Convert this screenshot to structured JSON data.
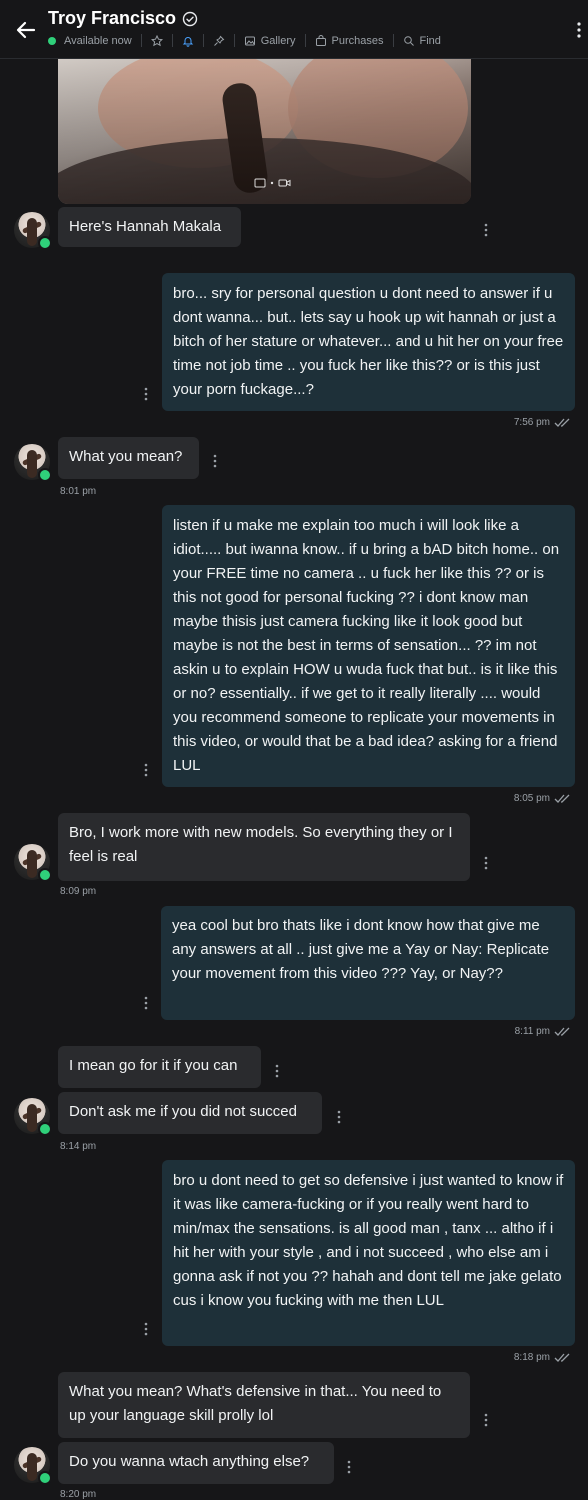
{
  "header": {
    "title": "Troy Francisco",
    "status": "Available now",
    "links": {
      "gallery": "Gallery",
      "purchases": "Purchases",
      "find": "Find"
    }
  },
  "messages": [
    {
      "side": "in",
      "text": "Here's Hannah Makala",
      "time": ""
    },
    {
      "side": "out",
      "text": "bro... sry for personal question u dont need to answer if u dont wanna... but.. lets say u hook up wit hannah or just a bitch of her stature or whatever... and u hit her on your free time not job time .. you fuck her like this?? or is this just your porn fuckage...?",
      "time": "7:56 pm"
    },
    {
      "side": "in",
      "text": "What you mean?",
      "time": "8:01 pm"
    },
    {
      "side": "out",
      "text": "listen if u make me explain too much i will look like a idiot..... but iwanna know.. if u bring a bAD bitch home.. on your FREE time no camera .. u fuck her like this ?? or is this not good for personal fucking ?? i dont know man maybe thisis just camera fucking like it look good but maybe is not the best in terms of sensation... ?? im not askin u to explain HOW u wuda fuck that but.. is it like this or no? essentially.. if we get to it really literally .... would you recommend someone to replicate your movements in this video, or would that be a bad idea? asking for a friend LUL",
      "time": "8:05 pm"
    },
    {
      "side": "in",
      "text": "Bro, I work more with new models. So everything they or I feel is real",
      "time": "8:09 pm"
    },
    {
      "side": "out",
      "text": "yea cool but bro thats like i dont know how that give me any answers at all .. just give me a Yay or Nay: Replicate your movement from this video ??? Yay, or Nay??",
      "time": "8:11 pm"
    },
    {
      "side": "in",
      "text": "I mean go for it if you can",
      "time": ""
    },
    {
      "side": "in",
      "text": "Don't ask me if you did not succed",
      "time": "8:14 pm"
    },
    {
      "side": "out",
      "text": "bro u dont need to get so defensive i just wanted to know if it was like camera-fucking or if you really went hard to min/max the sensations. is all good man , tanx ... altho if i hit her with your style , and i not succeed , who else am i gonna ask if not you ?? hahah and dont tell me jake gelato cus i know you fucking with me then LUL",
      "time": "8:18 pm"
    },
    {
      "side": "in",
      "text": "What you mean? What's defensive in that... You need to up your language skill prolly lol",
      "time": ""
    },
    {
      "side": "in",
      "text": "Do you wanna wtach anything else?",
      "time": "8:20 pm"
    }
  ],
  "colors": {
    "background": "#161618",
    "incoming_bubble": "#2a2b2e",
    "outgoing_bubble": "#1e3039",
    "online": "#2fd07a",
    "accent": "#4aa3ff"
  },
  "icons": [
    "back-arrow-icon",
    "verified-icon",
    "star-icon",
    "bell-icon",
    "pin-icon",
    "gallery-icon",
    "purchases-icon",
    "search-icon",
    "kebab-icon",
    "double-check-icon"
  ]
}
